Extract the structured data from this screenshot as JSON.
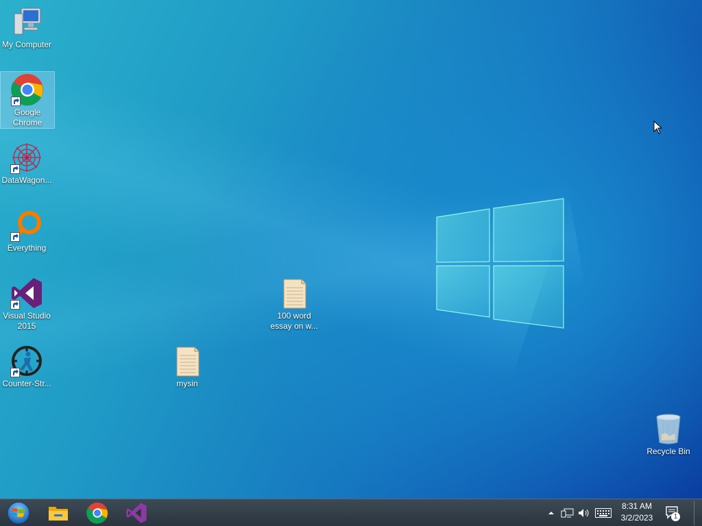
{
  "desktop": {
    "icons": [
      {
        "label": "My Computer",
        "icon": "computer-icon"
      },
      {
        "label": "Google Chrome",
        "icon": "chrome-icon",
        "selected": true
      },
      {
        "label": "DataWagon...",
        "icon": "datawagon-icon"
      },
      {
        "label": "Everything",
        "icon": "everything-icon"
      },
      {
        "label": "Visual Studio 2015",
        "icon": "visual-studio-icon"
      },
      {
        "label": "Counter-Str...",
        "icon": "counter-strike-icon"
      },
      {
        "label": "100 word essay on w...",
        "icon": "text-file-icon"
      },
      {
        "label": "mysin",
        "icon": "text-file-icon"
      },
      {
        "label": "Recycle Bin",
        "icon": "recycle-bin-icon"
      }
    ]
  },
  "taskbar": {
    "pinned": [
      {
        "name": "start",
        "icon": "windows-start-orb-icon"
      },
      {
        "name": "file-explorer",
        "icon": "folder-icon"
      },
      {
        "name": "google-chrome",
        "icon": "chrome-icon"
      },
      {
        "name": "visual-studio",
        "icon": "visual-studio-icon"
      }
    ],
    "tray": {
      "icons": [
        "chevron-up-icon",
        "network-icon",
        "volume-icon",
        "keyboard-icon"
      ],
      "time": "8:31 AM",
      "date": "3/2/2023",
      "notification_count": "1"
    }
  },
  "colors": {
    "wallpaper_left": "#2bb1cc",
    "wallpaper_right": "#0a3d9f",
    "taskbar": "#2a343d"
  }
}
